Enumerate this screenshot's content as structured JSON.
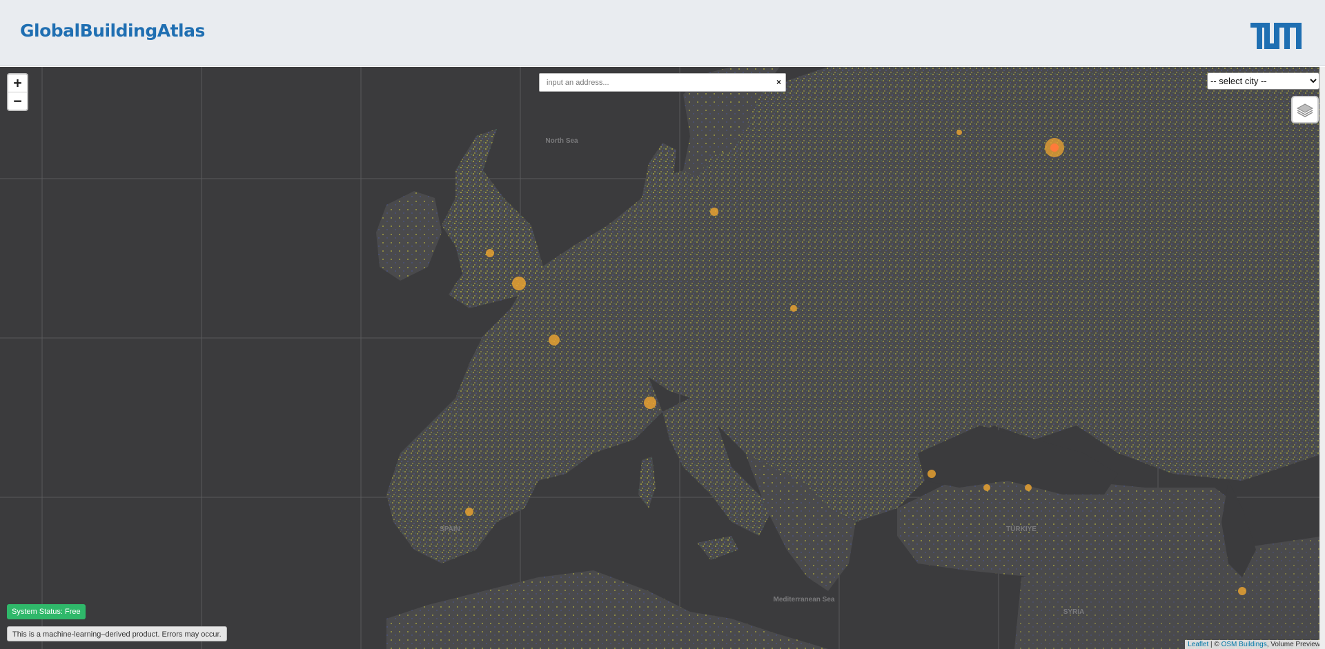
{
  "header": {
    "title": "GlobalBuildingAtlas",
    "logo_text": "TUM"
  },
  "map": {
    "zoom_in_label": "+",
    "zoom_out_label": "−",
    "search": {
      "placeholder": "input an address...",
      "clear_label": "×"
    },
    "city_select": {
      "selected": "-- select city --"
    },
    "layers_icon": "layers-icon",
    "labels": [
      {
        "text": "North Sea",
        "name": "label-north-sea"
      },
      {
        "text": "Mediterranean Sea",
        "name": "label-mediterranean"
      },
      {
        "text": "SPAIN",
        "name": "label-spain"
      },
      {
        "text": "TÜRKIYE",
        "name": "label-turkiye"
      },
      {
        "text": "SYRIA",
        "name": "label-syria"
      }
    ],
    "colors": {
      "background": "#3b3b3d",
      "land": "#4a4a4c",
      "sea": "#3b3b3d",
      "density_low": "#4b58a8",
      "density_mid": "#c9c63b",
      "density_high": "#f0a630"
    }
  },
  "footer": {
    "status": "System Status: Free",
    "disclaimer": "This is a machine-learning–derived product. Errors may occur.",
    "attribution": {
      "leaflet": "Leaflet",
      "sep": " | © ",
      "osm": "OSM Buildings",
      "rest": ", Volume Preview"
    }
  }
}
